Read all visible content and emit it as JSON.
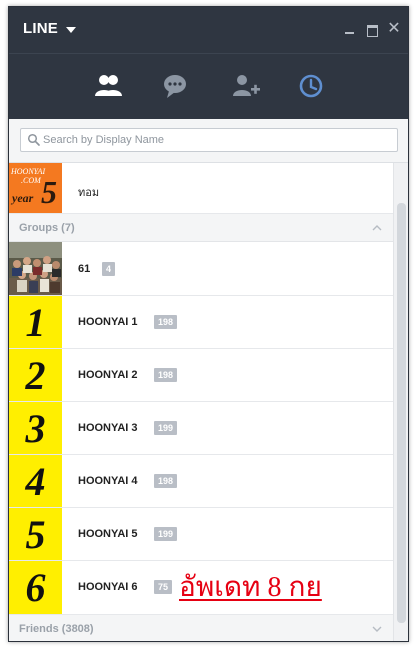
{
  "app": {
    "title": "LINE",
    "window_controls": {
      "minimize": "minimize-icon",
      "maximize": "maximize-icon",
      "close": "✕"
    }
  },
  "nav": {
    "tabs": [
      {
        "icon": "friends-icon",
        "active": true
      },
      {
        "icon": "chat-bubble-icon",
        "active": false
      },
      {
        "icon": "add-friend-icon",
        "active": false
      },
      {
        "icon": "clock-icon",
        "active": false
      }
    ]
  },
  "search": {
    "placeholder": "Search by Display Name",
    "value": ""
  },
  "profile": {
    "name": "ทอม",
    "avatar": {
      "line1": "HOONYAI",
      "line2": ".COM",
      "line3": "year",
      "digit": "5"
    }
  },
  "groups": {
    "header": "Groups (7)",
    "items": [
      {
        "name": "61",
        "count": "4",
        "thumb": "photo"
      },
      {
        "name": "HOONYAI 1",
        "count": "198",
        "tile": "1"
      },
      {
        "name": "HOONYAI 2",
        "count": "198",
        "tile": "2"
      },
      {
        "name": "HOONYAI 3",
        "count": "199",
        "tile": "3"
      },
      {
        "name": "HOONYAI 4",
        "count": "198",
        "tile": "4"
      },
      {
        "name": "HOONYAI 5",
        "count": "199",
        "tile": "5"
      },
      {
        "name": "HOONYAI 6",
        "count": "75",
        "tile": "6"
      }
    ]
  },
  "friends": {
    "header": "Friends (3808)"
  },
  "annotation": {
    "text": "อัพเดท 8 กย"
  },
  "colors": {
    "titlebar": "#2f3641",
    "tile_yellow": "#ffef00",
    "annotation_red": "#e60012",
    "badge": "#b9bec6",
    "profile_orange": "#f47920"
  }
}
